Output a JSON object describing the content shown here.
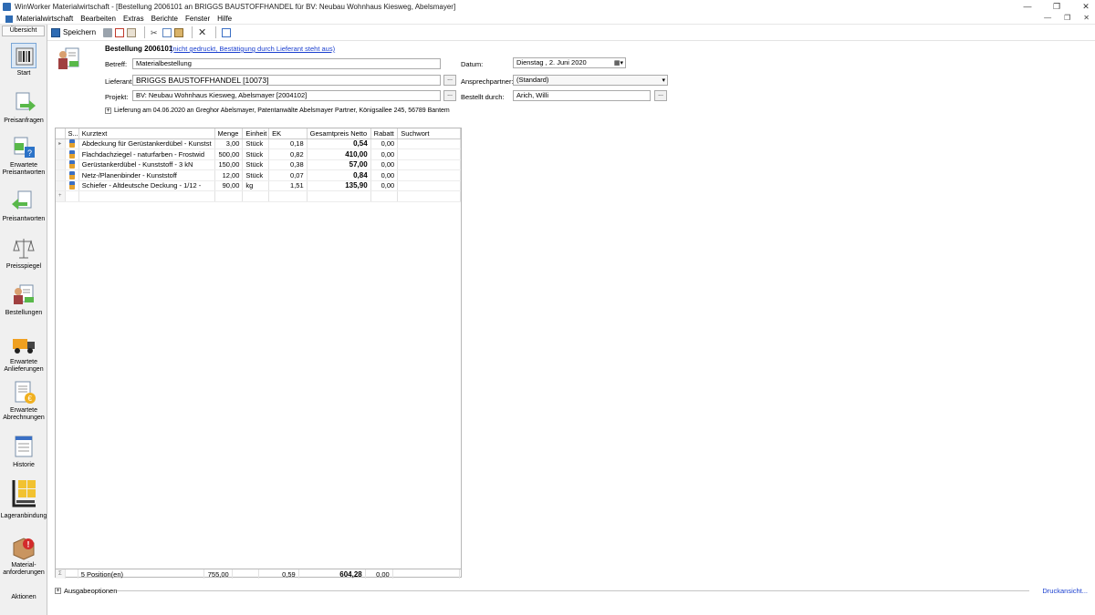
{
  "window": {
    "title": "WinWorker Materialwirtschaft - [Bestellung 2006101 an BRIGGS BAUSTOFFHANDEL für BV: Neubau Wohnhaus Kiesweg, Abelsmayer]",
    "controls": [
      "—",
      "❐",
      "✕"
    ]
  },
  "menu": {
    "items": [
      "Materialwirtschaft",
      "Bearbeiten",
      "Extras",
      "Berichte",
      "Fenster",
      "Hilfe"
    ],
    "mdi_controls": [
      "—",
      "❐",
      "✕"
    ]
  },
  "sidebar": {
    "header": "Übersicht",
    "items": [
      {
        "label": "Start",
        "icon": "barcode-icon"
      },
      {
        "label": "Preisanfragen",
        "icon": "document-arrow-icon"
      },
      {
        "label": "Erwartete Preisantworten",
        "icon": "question-document-icon"
      },
      {
        "label": "Preisantworten",
        "icon": "answer-document-icon"
      },
      {
        "label": "Preisspiegel",
        "icon": "scale-icon"
      },
      {
        "label": "Bestellungen",
        "icon": "order-document-icon"
      },
      {
        "label": "Erwartete Anlieferungen",
        "icon": "truck-icon"
      },
      {
        "label": "Erwartete Abrechnungen",
        "icon": "invoice-document-icon"
      },
      {
        "label": "Historie",
        "icon": "history-document-icon"
      },
      {
        "label": "Lageranbindung",
        "icon": "warehouse-icon"
      },
      {
        "label": "Material-anforderungen",
        "icon": "box-alert-icon"
      }
    ],
    "footer": "Aktionen"
  },
  "toolbar": {
    "save_label": "Speichern"
  },
  "order": {
    "title": "Bestellung 2006101",
    "status": "(nicht gedruckt, Bestätigung durch Lieferant steht aus)",
    "labels": {
      "betreff": "Betreff:",
      "lieferant": "Lieferant:",
      "projekt": "Projekt:",
      "datum": "Datum:",
      "ansprechpartner": "Ansprechpartner:",
      "bestellt_durch": "Bestellt durch:"
    },
    "betreff": "Materialbestellung",
    "lieferant": "BRIGGS BAUSTOFFHANDEL [10073]",
    "projekt": "BV: Neubau Wohnhaus Kiesweg, Abelsmayer [2004102]",
    "datum": "Dienstag ,    2.      Juni       2020",
    "ansprechpartner": "(Standard)",
    "bestellt_durch": "Arich, Willi",
    "dots": "...",
    "delivery": "Lieferung am 04.06.2020 an Greghor Abelsmayer, Patentanwälte  Abelsmayer  Partner, Königsallee 245, 56789 Bantem"
  },
  "grid": {
    "columns": [
      "S...",
      "Kurztext",
      "Menge",
      "Einheit",
      "EK",
      "Gesamtpreis Netto",
      "Rabatt",
      "Suchwort"
    ],
    "rows": [
      {
        "kurztext": "Abdeckung für Gerüstankerdübel - Kunstst",
        "menge": "3,00",
        "einheit": "Stück",
        "ek": "0,18",
        "gesamt": "0,54",
        "rabatt": "0,00",
        "suchwort": ""
      },
      {
        "kurztext": "Flachdachziegel - naturfarben - Frostwid",
        "menge": "500,00",
        "einheit": "Stück",
        "ek": "0,82",
        "gesamt": "410,00",
        "rabatt": "0,00",
        "suchwort": ""
      },
      {
        "kurztext": "Gerüstankerdübel - Kunststoff - 3 kN",
        "menge": "150,00",
        "einheit": "Stück",
        "ek": "0,38",
        "gesamt": "57,00",
        "rabatt": "0,00",
        "suchwort": ""
      },
      {
        "kurztext": "Netz-/Planenbinder - Kunststoff",
        "menge": "12,00",
        "einheit": "Stück",
        "ek": "0,07",
        "gesamt": "0,84",
        "rabatt": "0,00",
        "suchwort": ""
      },
      {
        "kurztext": "Schiefer - Altdeutsche Deckung - 1/12 -",
        "menge": "90,00",
        "einheit": "kg",
        "ek": "1,51",
        "gesamt": "135,90",
        "rabatt": "0,00",
        "suchwort": ""
      }
    ],
    "summary": {
      "sigma": "Σ",
      "positions": "5 Position(en)",
      "menge": "755,00",
      "ek": "0,59",
      "gesamt": "604,28",
      "rabatt": "0,00"
    }
  },
  "bottom": {
    "ausgabe": "Ausgabeoptionen",
    "druck": "Druckansicht..."
  }
}
